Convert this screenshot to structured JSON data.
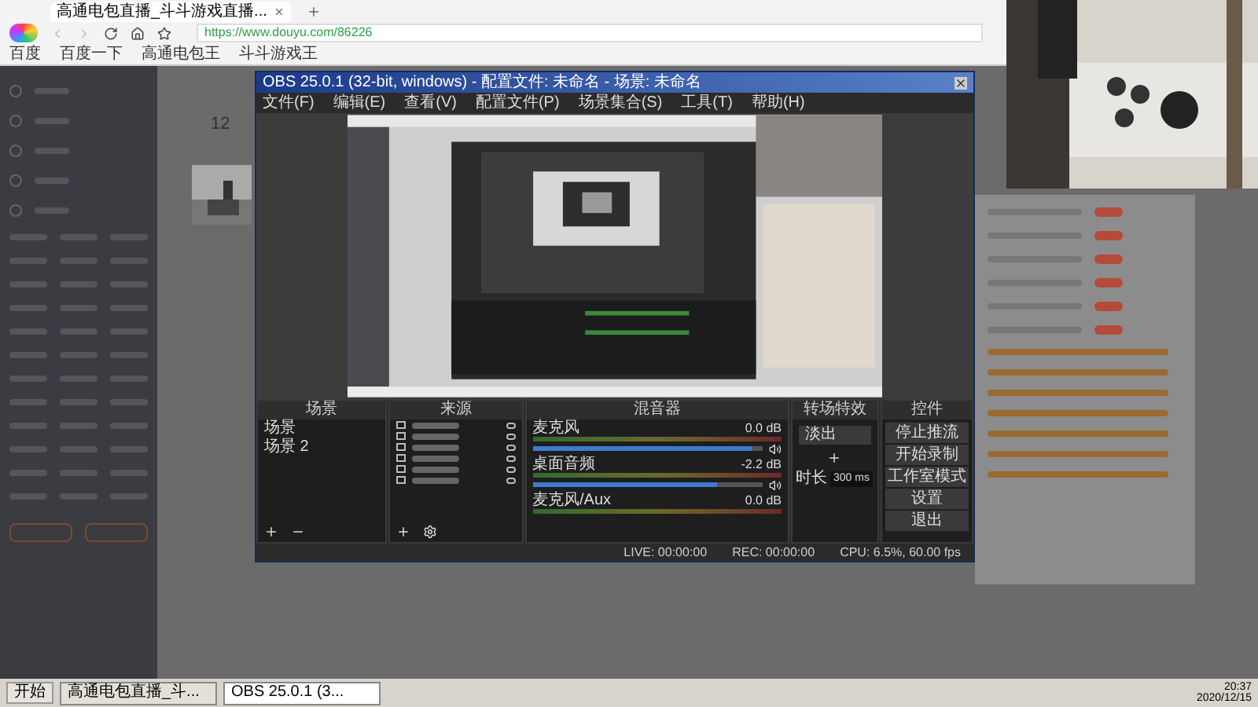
{
  "browser": {
    "tab_title": "高通电包直播_斗斗游戏直播...",
    "url": "https://www.douyu.com/86226",
    "bookmarks": [
      "百度",
      "百度一下",
      "高通电包王",
      "斗斗游戏王"
    ]
  },
  "page": {
    "count": "12"
  },
  "obs": {
    "title": "OBS 25.0.1 (32-bit, windows) - 配置文件: 未命名 - 场景: 未命名",
    "menu": [
      "文件(F)",
      "编辑(E)",
      "查看(V)",
      "配置文件(P)",
      "场景集合(S)",
      "工具(T)",
      "帮助(H)"
    ],
    "scenes": {
      "title": "场景",
      "items": [
        "场景",
        "场景 2"
      ]
    },
    "sources": {
      "title": "来源"
    },
    "mixer": {
      "title": "混音器",
      "tracks": [
        {
          "name": "麦克风",
          "reading": "0.0 dB",
          "level": 0.95
        },
        {
          "name": "桌面音频",
          "reading": "-2.2 dB",
          "level": 0.8
        },
        {
          "name": "麦克风/Aux",
          "reading": "0.0 dB"
        }
      ]
    },
    "transitions": {
      "title": "转场特效",
      "type": "淡出",
      "duration_label": "时长",
      "duration": "300 ms"
    },
    "controls": {
      "title": "控件",
      "buttons": [
        "停止推流",
        "开始录制",
        "工作室模式",
        "设置",
        "退出"
      ]
    },
    "status": [
      "LIVE: 00:00:00",
      "REC: 00:00:00",
      "CPU: 6.5%, 60.00 fps"
    ]
  },
  "taskbar": {
    "start": "开始",
    "tasks": [
      {
        "label": "高通电包直播_斗...",
        "selected": false
      },
      {
        "label": "OBS 25.0.1 (3...",
        "selected": true
      }
    ],
    "time": "20:37",
    "date": "2020/12/15"
  }
}
